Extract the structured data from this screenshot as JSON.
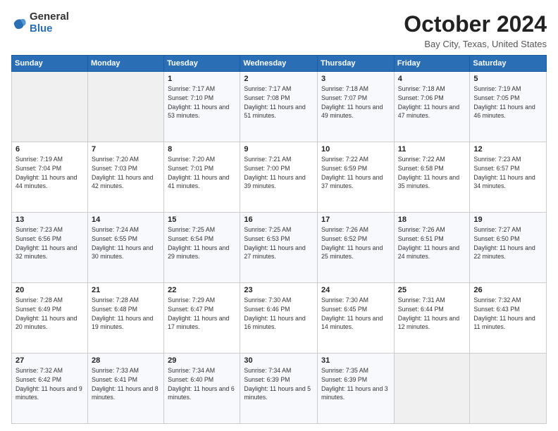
{
  "logo": {
    "general": "General",
    "blue": "Blue"
  },
  "title": {
    "month": "October 2024",
    "location": "Bay City, Texas, United States"
  },
  "headers": [
    "Sunday",
    "Monday",
    "Tuesday",
    "Wednesday",
    "Thursday",
    "Friday",
    "Saturday"
  ],
  "weeks": [
    [
      {
        "day": "",
        "sunrise": "",
        "sunset": "",
        "daylight": ""
      },
      {
        "day": "",
        "sunrise": "",
        "sunset": "",
        "daylight": ""
      },
      {
        "day": "1",
        "sunrise": "Sunrise: 7:17 AM",
        "sunset": "Sunset: 7:10 PM",
        "daylight": "Daylight: 11 hours and 53 minutes."
      },
      {
        "day": "2",
        "sunrise": "Sunrise: 7:17 AM",
        "sunset": "Sunset: 7:08 PM",
        "daylight": "Daylight: 11 hours and 51 minutes."
      },
      {
        "day": "3",
        "sunrise": "Sunrise: 7:18 AM",
        "sunset": "Sunset: 7:07 PM",
        "daylight": "Daylight: 11 hours and 49 minutes."
      },
      {
        "day": "4",
        "sunrise": "Sunrise: 7:18 AM",
        "sunset": "Sunset: 7:06 PM",
        "daylight": "Daylight: 11 hours and 47 minutes."
      },
      {
        "day": "5",
        "sunrise": "Sunrise: 7:19 AM",
        "sunset": "Sunset: 7:05 PM",
        "daylight": "Daylight: 11 hours and 46 minutes."
      }
    ],
    [
      {
        "day": "6",
        "sunrise": "Sunrise: 7:19 AM",
        "sunset": "Sunset: 7:04 PM",
        "daylight": "Daylight: 11 hours and 44 minutes."
      },
      {
        "day": "7",
        "sunrise": "Sunrise: 7:20 AM",
        "sunset": "Sunset: 7:03 PM",
        "daylight": "Daylight: 11 hours and 42 minutes."
      },
      {
        "day": "8",
        "sunrise": "Sunrise: 7:20 AM",
        "sunset": "Sunset: 7:01 PM",
        "daylight": "Daylight: 11 hours and 41 minutes."
      },
      {
        "day": "9",
        "sunrise": "Sunrise: 7:21 AM",
        "sunset": "Sunset: 7:00 PM",
        "daylight": "Daylight: 11 hours and 39 minutes."
      },
      {
        "day": "10",
        "sunrise": "Sunrise: 7:22 AM",
        "sunset": "Sunset: 6:59 PM",
        "daylight": "Daylight: 11 hours and 37 minutes."
      },
      {
        "day": "11",
        "sunrise": "Sunrise: 7:22 AM",
        "sunset": "Sunset: 6:58 PM",
        "daylight": "Daylight: 11 hours and 35 minutes."
      },
      {
        "day": "12",
        "sunrise": "Sunrise: 7:23 AM",
        "sunset": "Sunset: 6:57 PM",
        "daylight": "Daylight: 11 hours and 34 minutes."
      }
    ],
    [
      {
        "day": "13",
        "sunrise": "Sunrise: 7:23 AM",
        "sunset": "Sunset: 6:56 PM",
        "daylight": "Daylight: 11 hours and 32 minutes."
      },
      {
        "day": "14",
        "sunrise": "Sunrise: 7:24 AM",
        "sunset": "Sunset: 6:55 PM",
        "daylight": "Daylight: 11 hours and 30 minutes."
      },
      {
        "day": "15",
        "sunrise": "Sunrise: 7:25 AM",
        "sunset": "Sunset: 6:54 PM",
        "daylight": "Daylight: 11 hours and 29 minutes."
      },
      {
        "day": "16",
        "sunrise": "Sunrise: 7:25 AM",
        "sunset": "Sunset: 6:53 PM",
        "daylight": "Daylight: 11 hours and 27 minutes."
      },
      {
        "day": "17",
        "sunrise": "Sunrise: 7:26 AM",
        "sunset": "Sunset: 6:52 PM",
        "daylight": "Daylight: 11 hours and 25 minutes."
      },
      {
        "day": "18",
        "sunrise": "Sunrise: 7:26 AM",
        "sunset": "Sunset: 6:51 PM",
        "daylight": "Daylight: 11 hours and 24 minutes."
      },
      {
        "day": "19",
        "sunrise": "Sunrise: 7:27 AM",
        "sunset": "Sunset: 6:50 PM",
        "daylight": "Daylight: 11 hours and 22 minutes."
      }
    ],
    [
      {
        "day": "20",
        "sunrise": "Sunrise: 7:28 AM",
        "sunset": "Sunset: 6:49 PM",
        "daylight": "Daylight: 11 hours and 20 minutes."
      },
      {
        "day": "21",
        "sunrise": "Sunrise: 7:28 AM",
        "sunset": "Sunset: 6:48 PM",
        "daylight": "Daylight: 11 hours and 19 minutes."
      },
      {
        "day": "22",
        "sunrise": "Sunrise: 7:29 AM",
        "sunset": "Sunset: 6:47 PM",
        "daylight": "Daylight: 11 hours and 17 minutes."
      },
      {
        "day": "23",
        "sunrise": "Sunrise: 7:30 AM",
        "sunset": "Sunset: 6:46 PM",
        "daylight": "Daylight: 11 hours and 16 minutes."
      },
      {
        "day": "24",
        "sunrise": "Sunrise: 7:30 AM",
        "sunset": "Sunset: 6:45 PM",
        "daylight": "Daylight: 11 hours and 14 minutes."
      },
      {
        "day": "25",
        "sunrise": "Sunrise: 7:31 AM",
        "sunset": "Sunset: 6:44 PM",
        "daylight": "Daylight: 11 hours and 12 minutes."
      },
      {
        "day": "26",
        "sunrise": "Sunrise: 7:32 AM",
        "sunset": "Sunset: 6:43 PM",
        "daylight": "Daylight: 11 hours and 11 minutes."
      }
    ],
    [
      {
        "day": "27",
        "sunrise": "Sunrise: 7:32 AM",
        "sunset": "Sunset: 6:42 PM",
        "daylight": "Daylight: 11 hours and 9 minutes."
      },
      {
        "day": "28",
        "sunrise": "Sunrise: 7:33 AM",
        "sunset": "Sunset: 6:41 PM",
        "daylight": "Daylight: 11 hours and 8 minutes."
      },
      {
        "day": "29",
        "sunrise": "Sunrise: 7:34 AM",
        "sunset": "Sunset: 6:40 PM",
        "daylight": "Daylight: 11 hours and 6 minutes."
      },
      {
        "day": "30",
        "sunrise": "Sunrise: 7:34 AM",
        "sunset": "Sunset: 6:39 PM",
        "daylight": "Daylight: 11 hours and 5 minutes."
      },
      {
        "day": "31",
        "sunrise": "Sunrise: 7:35 AM",
        "sunset": "Sunset: 6:39 PM",
        "daylight": "Daylight: 11 hours and 3 minutes."
      },
      {
        "day": "",
        "sunrise": "",
        "sunset": "",
        "daylight": ""
      },
      {
        "day": "",
        "sunrise": "",
        "sunset": "",
        "daylight": ""
      }
    ]
  ]
}
